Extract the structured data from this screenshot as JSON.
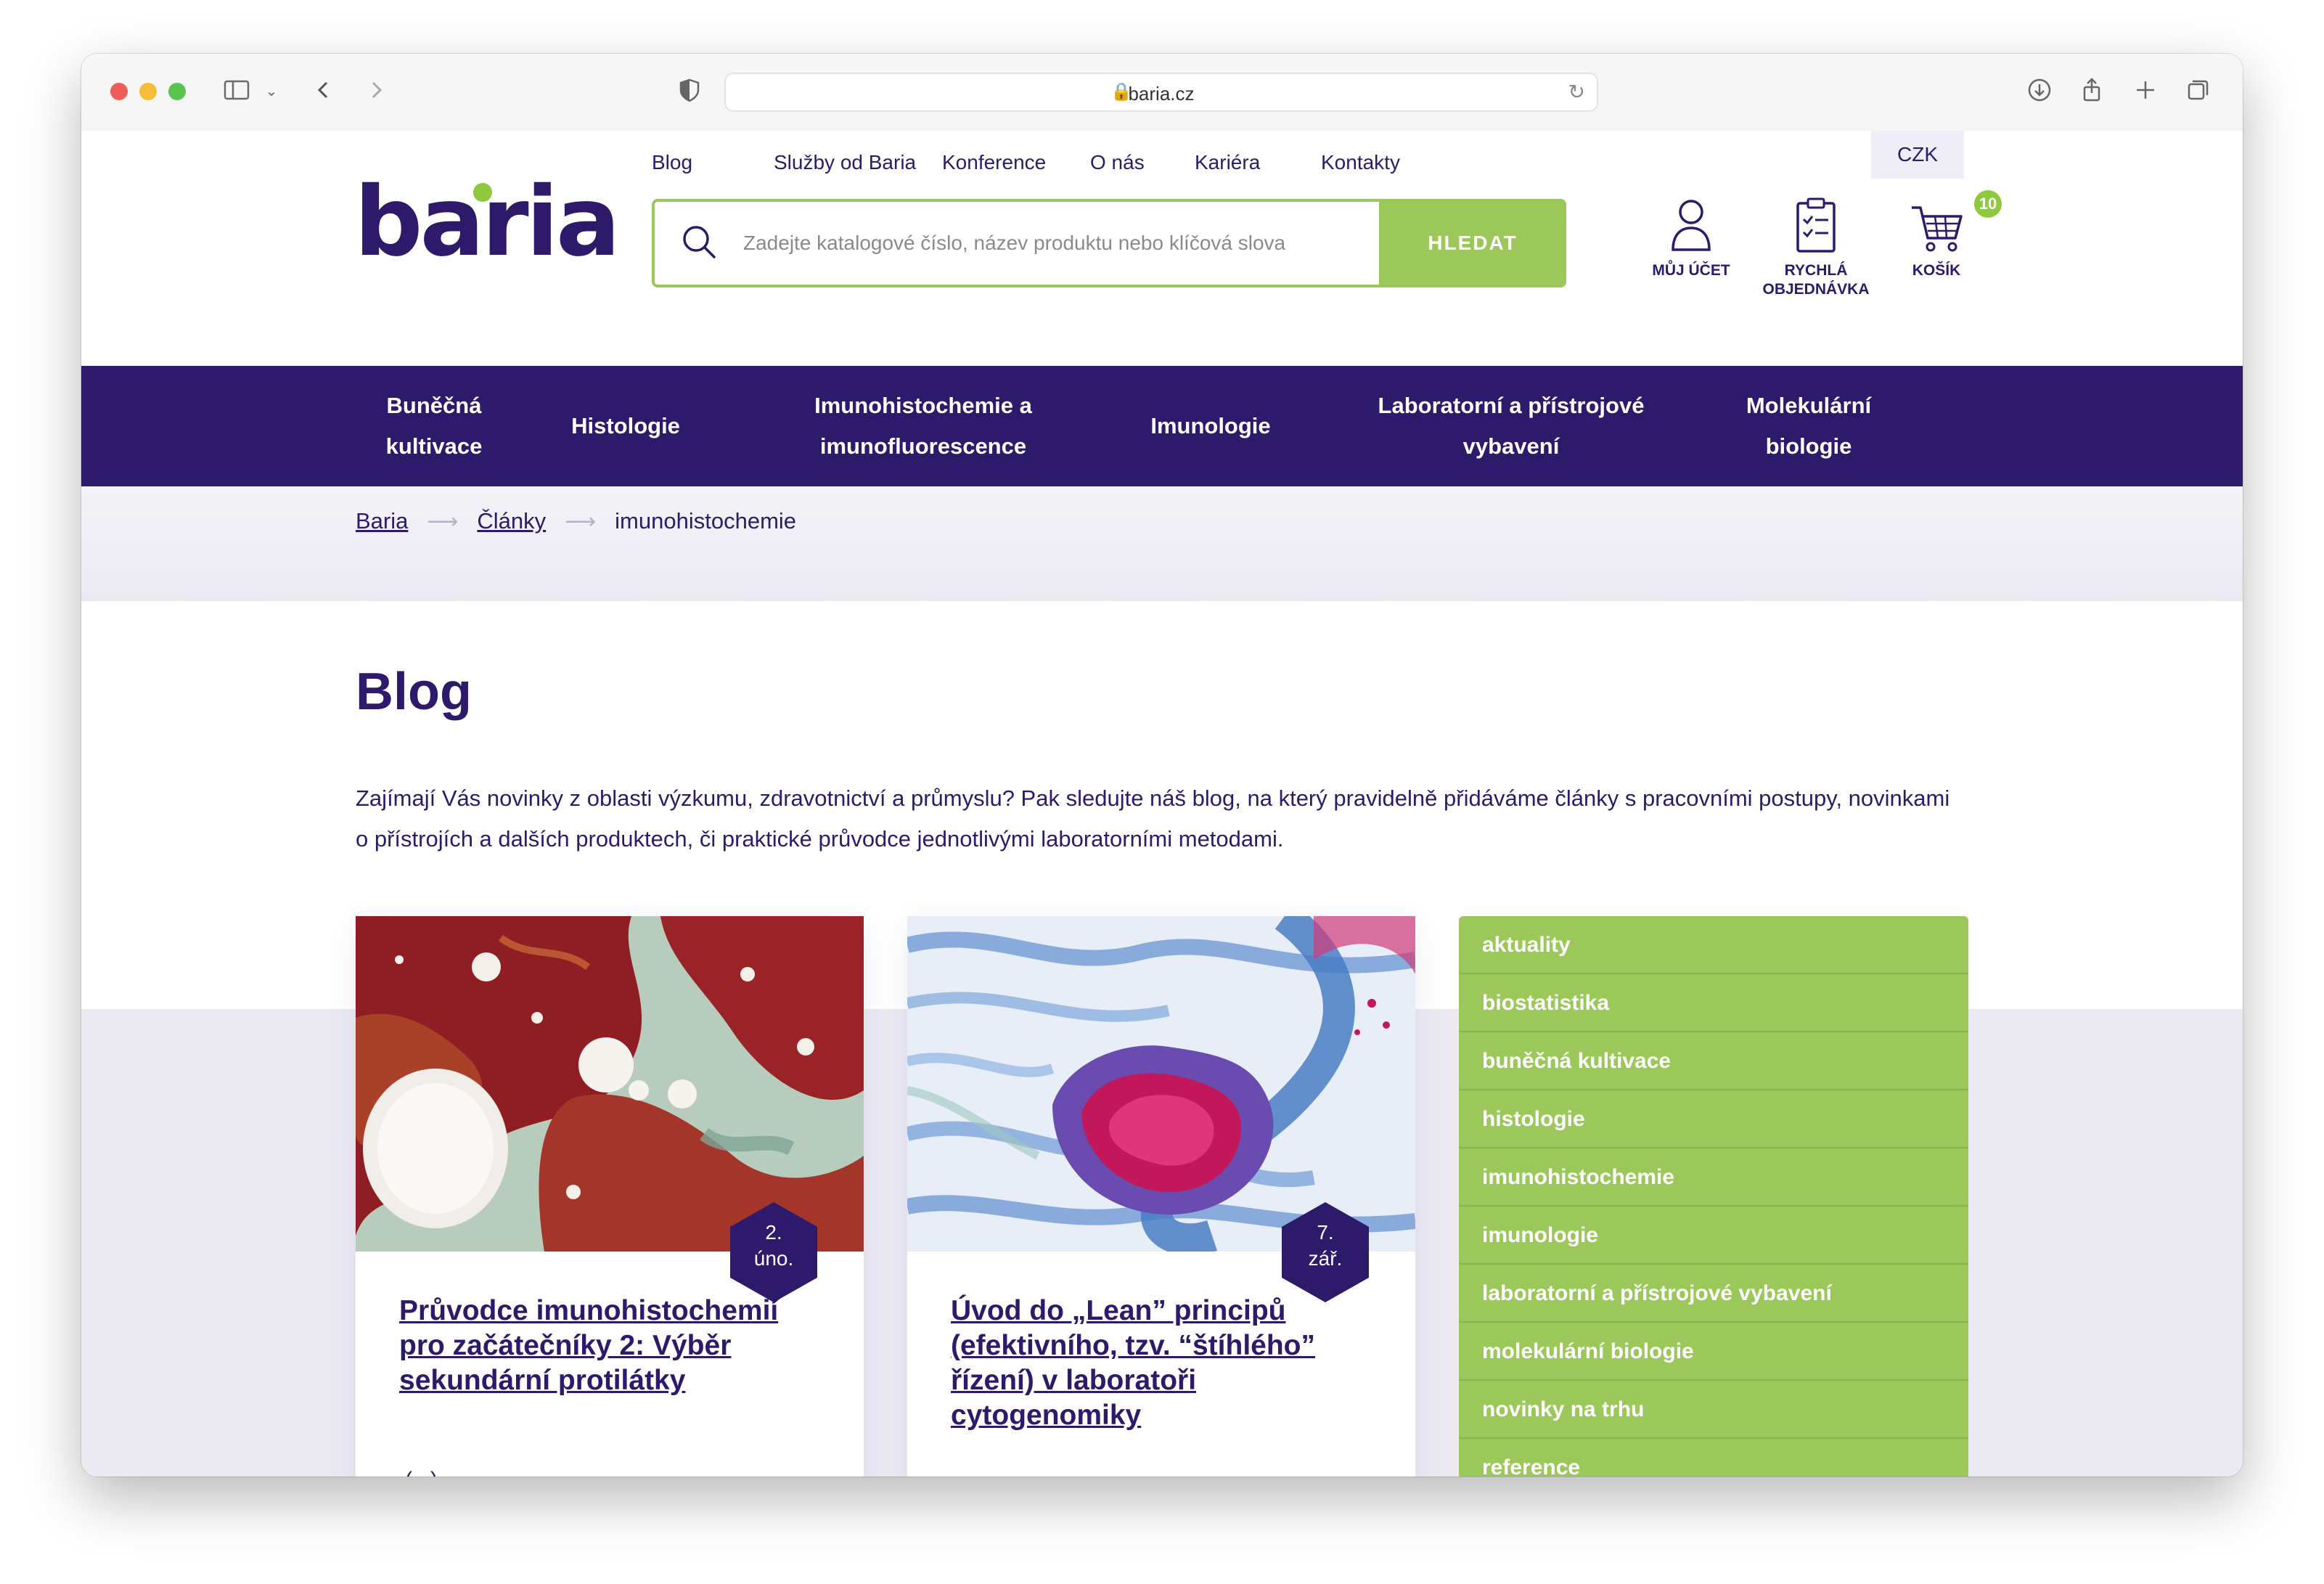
{
  "browser": {
    "url": "baria.cz"
  },
  "header": {
    "logo": "baria",
    "topnav": [
      "Blog",
      "Služby od Baria",
      "Konference",
      "O nás",
      "Kariéra",
      "Kontakty"
    ],
    "search_placeholder": "Zadejte katalogové číslo, název produktu nebo klíčová slova",
    "search_button": "HLEDAT",
    "currency": "CZK",
    "account_label": "MŮJ ÚČET",
    "quick_order_label_1": "RYCHLÁ",
    "quick_order_label_2": "OBJEDNÁVKA",
    "cart_label": "KOŠÍK",
    "cart_count": "10"
  },
  "categories": [
    {
      "line1": "Buněčná",
      "line2": "kultivace"
    },
    {
      "line1": "Histologie",
      "line2": ""
    },
    {
      "line1": "Imunohistochemie a",
      "line2": "imunofluorescence"
    },
    {
      "line1": "Imunologie",
      "line2": ""
    },
    {
      "line1": "Laboratorní a přístrojové",
      "line2": "vybavení"
    },
    {
      "line1": "Molekulární",
      "line2": "biologie"
    }
  ],
  "breadcrumb": {
    "items": [
      "Baria",
      "Články"
    ],
    "current": "imunohistochemie",
    "arrow": "⟶"
  },
  "page": {
    "title": "Blog",
    "intro": "Zajímají Vás novinky z oblasti výzkumu, zdravotnictví a průmyslu? Pak sledujte náš blog, na který pravidelně přidáváme články s pracovními postupy, novinkami o přístrojích a dalších produktech, či praktické průvodce jednotlivými laboratorními metodami."
  },
  "articles": [
    {
      "date_day": "2.",
      "date_month": "úno.",
      "title": "Průvodce imunohistochemií pro začátečníky 2: Výběr sekundární protilátky",
      "more": "(...)"
    },
    {
      "date_day": "7.",
      "date_month": "zář.",
      "title": "Úvod do „Lean” principů (efektivního, tzv. “štíhlého” řízení) v laboratoři cytogenomiky",
      "more": "(...)"
    }
  ],
  "tags": [
    "aktuality",
    "biostatistika",
    "buněčná kultivace",
    "histologie",
    "imunohistochemie",
    "imunologie",
    "laboratorní a přístrojové vybavení",
    "molekulární biologie",
    "novinky na trhu",
    "reference"
  ],
  "colors": {
    "brand_purple": "#2e1a6b",
    "accent_green": "#9cc75b"
  }
}
